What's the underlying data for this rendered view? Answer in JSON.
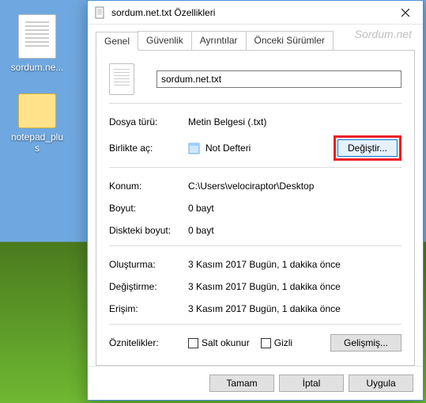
{
  "desktop": {
    "icons": [
      {
        "label": "sordum.ne..."
      },
      {
        "label": "notepad_plus"
      }
    ]
  },
  "watermark": "Sordum.net",
  "dialog": {
    "title": "sordum.net.txt Özellikleri",
    "tabs": {
      "general": "Genel",
      "security": "Güvenlik",
      "details": "Ayrıntılar",
      "previous": "Önceki Sürümler"
    },
    "filename": "sordum.net.txt",
    "labels": {
      "type": "Dosya türü:",
      "opens_with": "Birlikte aç:",
      "location": "Konum:",
      "size": "Boyut:",
      "size_on_disk": "Diskteki boyut:",
      "created": "Oluşturma:",
      "modified": "Değiştirme:",
      "accessed": "Erişim:",
      "attributes": "Öznitelikler:"
    },
    "values": {
      "type": "Metin Belgesi (.txt)",
      "opens_with": "Not Defteri",
      "location": "C:\\Users\\velociraptor\\Desktop",
      "size": "0 bayt",
      "size_on_disk": "0 bayt",
      "created": "3 Kasım 2017 Bugün, 1 dakika önce",
      "modified": "3 Kasım 2017 Bugün, 1 dakika önce",
      "accessed": "3 Kasım 2017 Bugün, 1 dakika önce"
    },
    "buttons": {
      "change": "Değiştir...",
      "advanced": "Gelişmiş...",
      "ok": "Tamam",
      "cancel": "İptal",
      "apply": "Uygula"
    },
    "checkboxes": {
      "readonly": "Salt okunur",
      "hidden": "Gizli"
    }
  }
}
